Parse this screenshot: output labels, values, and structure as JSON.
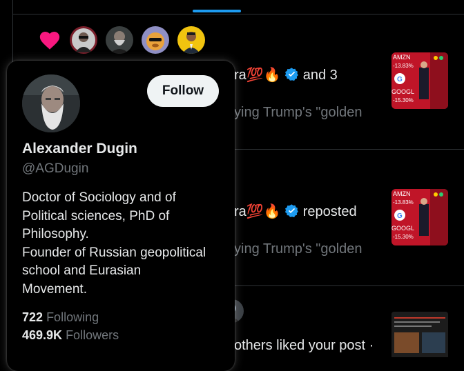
{
  "activity": {
    "reaction_icon": "heart-icon",
    "reaction_color": "#f91880",
    "avatars": [
      "avatar-1",
      "avatar-2",
      "avatar-3",
      "avatar-4"
    ]
  },
  "notifications": [
    {
      "actor_suffix": "ra",
      "emoji": "💯🔥",
      "action_text": "and 3",
      "preview": "ying Trump's \"golden"
    },
    {
      "actor_suffix": "ra",
      "emoji": "💯🔥",
      "action_text": "reposted",
      "preview": "ying Trump's \"golden"
    },
    {
      "action_text": "others liked your post ·"
    }
  ],
  "thumbnail": {
    "labels": [
      "AMZN",
      "-13.83%",
      "GOOGL",
      "-15.30%"
    ]
  },
  "hovercard": {
    "follow_label": "Follow",
    "name": "Alexander Dugin",
    "handle": "@AGDugin",
    "bio_lines": [
      "Doctor of Sociology and of",
      "Political sciences, PhD of",
      "Philosophy.",
      "Founder of Russian geopolitical",
      "school and Eurasian",
      "Movement."
    ],
    "following_count": "722",
    "following_label": "Following",
    "followers_count": "469.9K",
    "followers_label": "Followers"
  },
  "colors": {
    "accent": "#1d9bf0",
    "verified": "#1d9bf0",
    "muted_text": "#71767b",
    "follow_button_bg": "#eff3f4"
  }
}
